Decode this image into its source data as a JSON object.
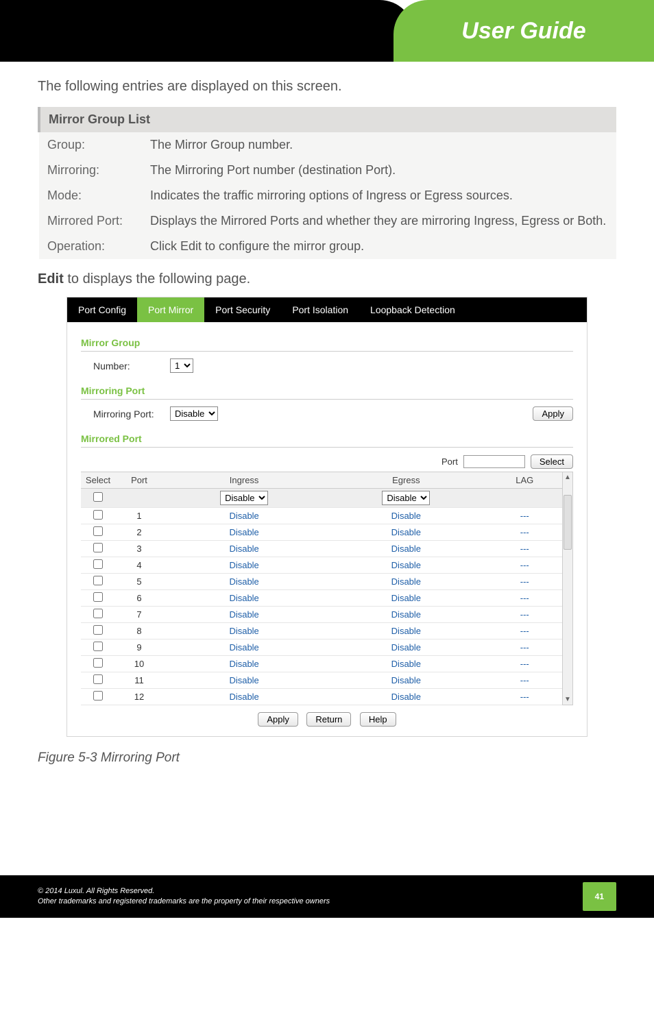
{
  "header": {
    "title": "User Guide"
  },
  "intro": "The following entries are displayed on this screen.",
  "mirror_list": {
    "heading": "Mirror Group List",
    "rows": [
      {
        "label": "Group:",
        "desc": "The Mirror Group number."
      },
      {
        "label": "Mirroring:",
        "desc": "The Mirroring Port number (destination Port)."
      },
      {
        "label": "Mode:",
        "desc": "Indicates the traffic mirroring options of Ingress or Egress sources."
      },
      {
        "label": "Mirrored Port:",
        "desc": "Displays the Mirrored Ports and whether they are mirroring Ingress, Egress or Both."
      },
      {
        "label": "Operation:",
        "desc_before": "Click ",
        "desc_bold": "Edit",
        "desc_after": " to configure the mirror group."
      }
    ]
  },
  "edit_line": {
    "bold": "Edit",
    "rest": " to displays the following page."
  },
  "tabs": {
    "items": [
      "Port Config",
      "Port Mirror",
      "Port Security",
      "Port Isolation",
      "Loopback Detection"
    ],
    "active_index": 1
  },
  "panel": {
    "mirror_group": {
      "title": "Mirror Group",
      "label": "Number:",
      "value": "1"
    },
    "mirroring_port": {
      "title": "Mirroring Port",
      "label": "Mirroring Port:",
      "value": "Disable",
      "apply": "Apply"
    },
    "mirrored_port": {
      "title": "Mirrored Port",
      "search_label": "Port",
      "search_btn": "Select",
      "headers": {
        "select": "Select",
        "port": "Port",
        "ingress": "Ingress",
        "egress": "Egress",
        "lag": "LAG"
      },
      "filter": {
        "ingress": "Disable",
        "egress": "Disable"
      },
      "rows": [
        {
          "port": "1",
          "ingress": "Disable",
          "egress": "Disable",
          "lag": "---"
        },
        {
          "port": "2",
          "ingress": "Disable",
          "egress": "Disable",
          "lag": "---"
        },
        {
          "port": "3",
          "ingress": "Disable",
          "egress": "Disable",
          "lag": "---"
        },
        {
          "port": "4",
          "ingress": "Disable",
          "egress": "Disable",
          "lag": "---"
        },
        {
          "port": "5",
          "ingress": "Disable",
          "egress": "Disable",
          "lag": "---"
        },
        {
          "port": "6",
          "ingress": "Disable",
          "egress": "Disable",
          "lag": "---"
        },
        {
          "port": "7",
          "ingress": "Disable",
          "egress": "Disable",
          "lag": "---"
        },
        {
          "port": "8",
          "ingress": "Disable",
          "egress": "Disable",
          "lag": "---"
        },
        {
          "port": "9",
          "ingress": "Disable",
          "egress": "Disable",
          "lag": "---"
        },
        {
          "port": "10",
          "ingress": "Disable",
          "egress": "Disable",
          "lag": "---"
        },
        {
          "port": "11",
          "ingress": "Disable",
          "egress": "Disable",
          "lag": "---"
        },
        {
          "port": "12",
          "ingress": "Disable",
          "egress": "Disable",
          "lag": "---"
        }
      ],
      "buttons": {
        "apply": "Apply",
        "return": "Return",
        "help": "Help"
      }
    }
  },
  "figure_caption": "Figure 5-3 Mirroring Port",
  "footer": {
    "line1": "© 2014  Luxul. All Rights Reserved.",
    "line2": "Other trademarks and registered trademarks are the property of their respective owners",
    "page": "41"
  }
}
